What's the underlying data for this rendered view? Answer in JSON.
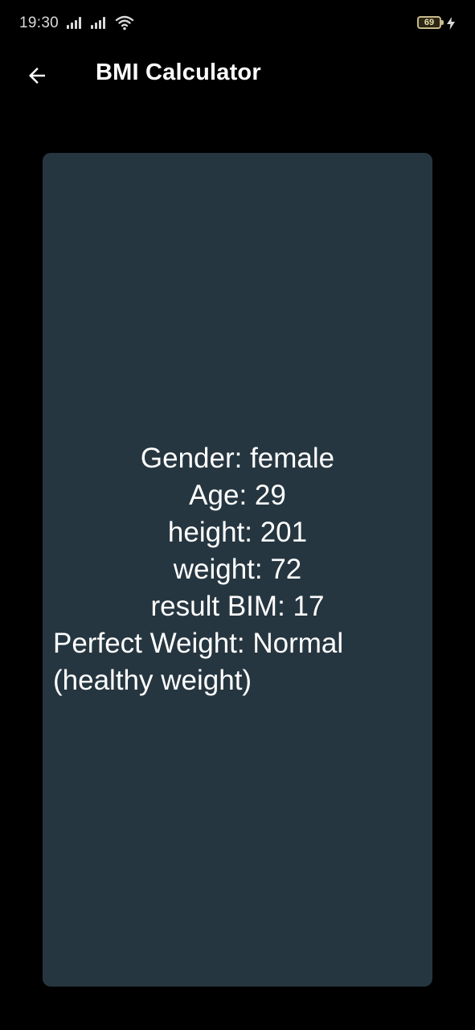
{
  "status_bar": {
    "time": "19:30",
    "battery_level": "69",
    "icons": [
      "signal-icon",
      "signal-icon",
      "wifi-icon",
      "battery-icon",
      "charging-bolt-icon"
    ]
  },
  "app_bar": {
    "back_icon": "arrow-left-icon",
    "title": "BMI Calculator"
  },
  "result": {
    "gender": "Gender: female",
    "age": "Age: 29",
    "height": "height: 201",
    "weight": "weight: 72",
    "bmi": "result BIM: 17",
    "verdict": "Perfect Weight: Normal (healthy weight)"
  },
  "colors": {
    "background": "#000000",
    "card": "#263640",
    "text": "#ffffff"
  }
}
